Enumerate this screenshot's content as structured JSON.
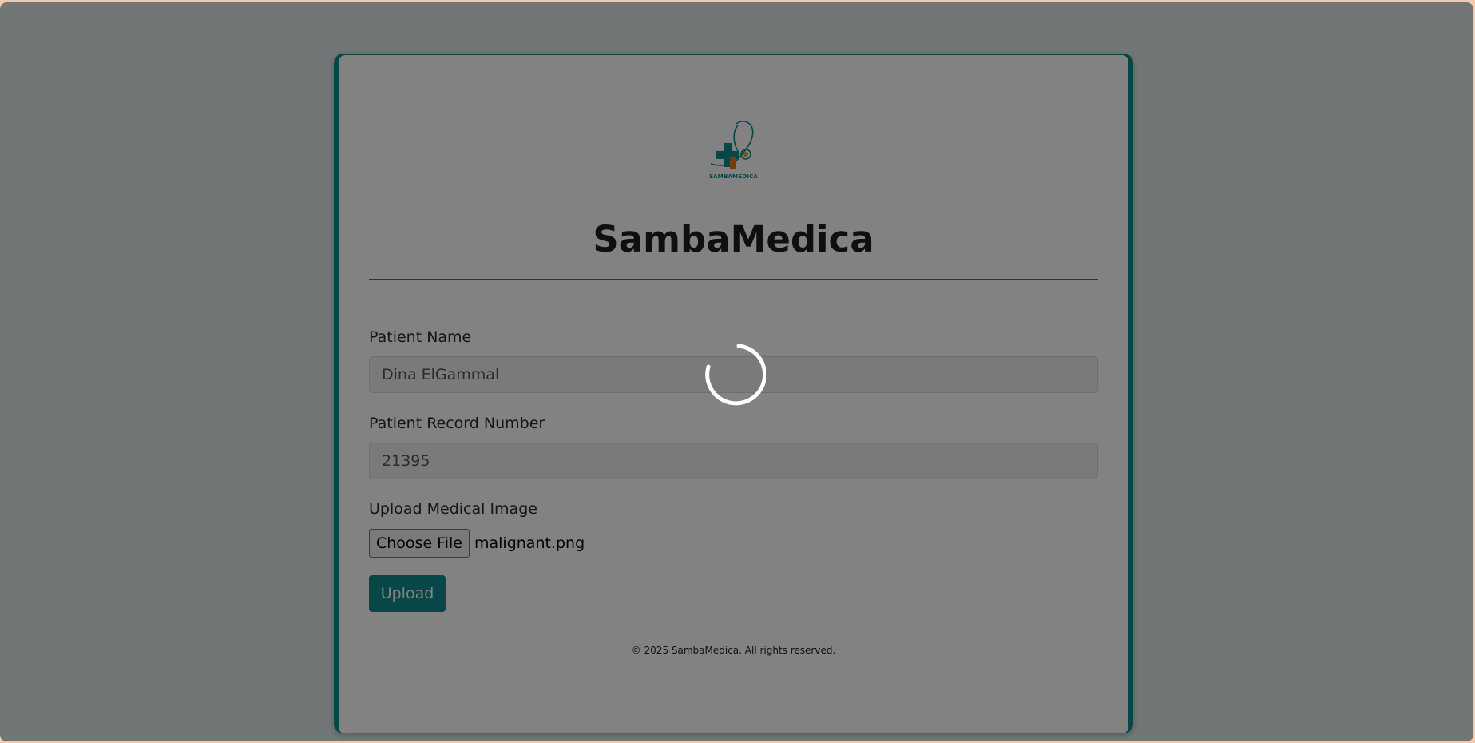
{
  "app": {
    "brand_logo_text": "SAMBAMEDICA",
    "title": "SambaMedica"
  },
  "form": {
    "patient_name": {
      "label": "Patient Name",
      "value": "Dina ElGammal"
    },
    "record_number": {
      "label": "Patient Record Number",
      "value": "21395"
    },
    "image_upload": {
      "label": "Upload Medical Image",
      "choose_button": "Choose File",
      "file_name": "malignant.png"
    },
    "submit_label": "Upload"
  },
  "footer": {
    "copyright": "© 2025 SambaMedica. All rights reserved."
  },
  "overlay": {
    "state": "loading",
    "icon": "loading-spinner-icon"
  },
  "colors": {
    "accent": "#0f8b8d",
    "page_background": "#dfe8e8",
    "card_background": "#ffffff",
    "overlay": "rgba(0,0,0,0.49)"
  }
}
